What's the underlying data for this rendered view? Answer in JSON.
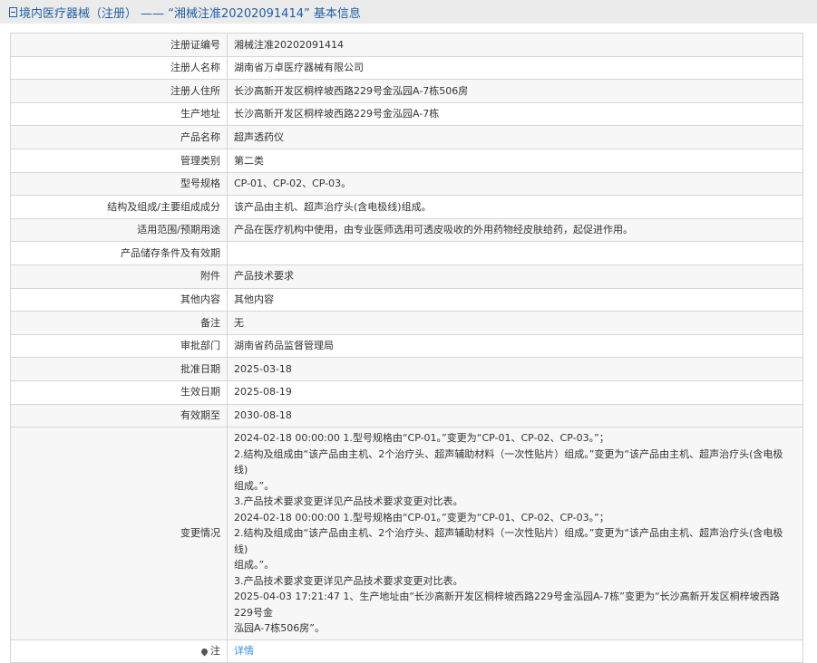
{
  "header": {
    "title": "境内医疗器械（注册） —— “湘械注准20202091414” 基本信息"
  },
  "rows": [
    {
      "label": "注册证编号",
      "value": "湘械注准20202091414"
    },
    {
      "label": "注册人名称",
      "value": "湖南省万卓医疗器械有限公司"
    },
    {
      "label": "注册人住所",
      "value": "长沙高新开发区桐梓坡西路229号金泓园A-7栋506房"
    },
    {
      "label": "生产地址",
      "value": "长沙高新开发区桐梓坡西路229号金泓园A-7栋"
    },
    {
      "label": "产品名称",
      "value": "超声透药仪"
    },
    {
      "label": "管理类别",
      "value": "第二类"
    },
    {
      "label": "型号规格",
      "value": "CP-01、CP-02、CP-03。"
    },
    {
      "label": "结构及组成/主要组成成分",
      "value": "该产品由主机、超声治疗头(含电极线)组成。"
    },
    {
      "label": "适用范围/预期用途",
      "value": "产品在医疗机构中使用，由专业医师选用可透皮吸收的外用药物经皮肤给药，起促进作用。"
    },
    {
      "label": "产品储存条件及有效期",
      "value": ""
    },
    {
      "label": "附件",
      "value": "产品技术要求"
    },
    {
      "label": "其他内容",
      "value": "其他内容"
    },
    {
      "label": "备注",
      "value": "无"
    },
    {
      "label": "审批部门",
      "value": "湖南省药品监督管理局"
    },
    {
      "label": "批准日期",
      "value": "2025-03-18"
    },
    {
      "label": "生效日期",
      "value": "2025-08-19"
    },
    {
      "label": "有效期至",
      "value": "2030-08-18"
    }
  ],
  "changes": {
    "label": "变更情况",
    "lines": [
      "2024-02-18 00:00:00 1.型号规格由“CP-01。”变更为“CP-01、CP-02、CP-03。”；",
      "2.结构及组成由“该产品由主机、2个治疗头、超声辅助材料（一次性贴片）组成。”变更为“该产品由主机、超声治疗头(含电极线)",
      "组成。”。",
      "3.产品技术要求变更详见产品技术要求变更对比表。",
      "2024-02-18 00:00:00 1.型号规格由“CP-01。”变更为“CP-01、CP-02、CP-03。”；",
      "2.结构及组成由“该产品由主机、2个治疗头、超声辅助材料（一次性贴片）组成。”变更为“该产品由主机、超声治疗头(含电极线)",
      "组成。”。",
      "3.产品技术要求变更详见产品技术要求变更对比表。",
      "2025-04-03 17:21:47 1、生产地址由“长沙高新开发区桐梓坡西路229号金泓园A-7栋”变更为“长沙高新开发区桐梓坡西路229号金",
      "泓园A-7栋506房”。"
    ]
  },
  "note": {
    "label": "注",
    "link": "详情"
  }
}
